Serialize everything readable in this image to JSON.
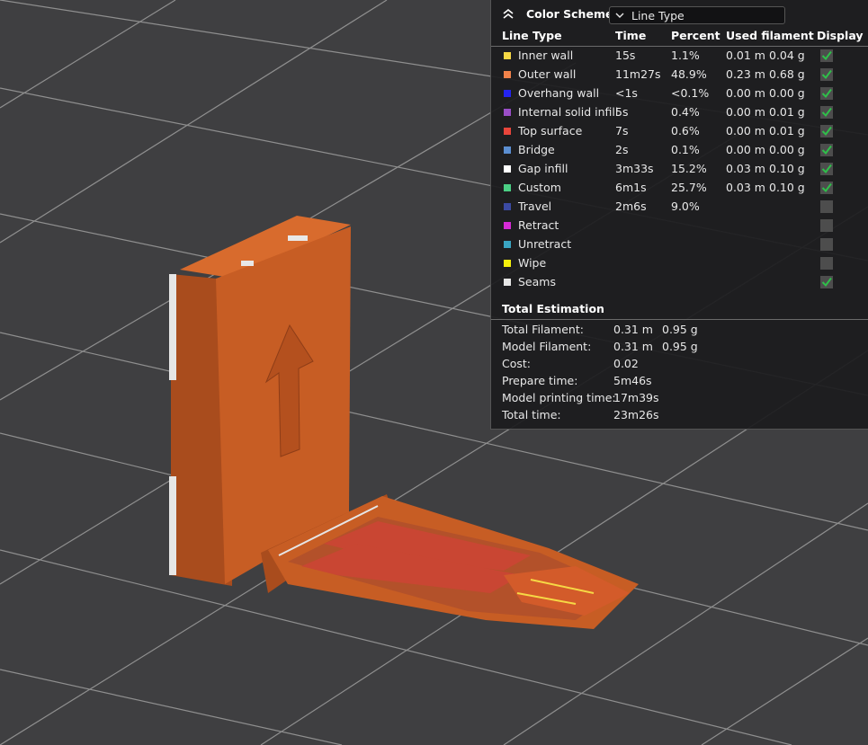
{
  "legend": {
    "scheme_label": "Color Scheme",
    "scheme_value": "Line Type",
    "headers": [
      "Line Type",
      "Time",
      "Percent",
      "Used filament",
      "Display"
    ],
    "rows": [
      {
        "name": "Inner wall",
        "color": "#f6d845",
        "time": "15s",
        "percent": "1.1%",
        "length": "0.01 m",
        "weight": "0.04 g",
        "checked": true
      },
      {
        "name": "Outer wall",
        "color": "#f0824a",
        "time": "11m27s",
        "percent": "48.9%",
        "length": "0.23 m",
        "weight": "0.68 g",
        "checked": true
      },
      {
        "name": "Overhang wall",
        "color": "#2424f0",
        "time": "<1s",
        "percent": "<0.1%",
        "length": "0.00 m",
        "weight": "0.00 g",
        "checked": true
      },
      {
        "name": "Internal solid infill",
        "color": "#9a4ec7",
        "time": "5s",
        "percent": "0.4%",
        "length": "0.00 m",
        "weight": "0.01 g",
        "checked": true
      },
      {
        "name": "Top surface",
        "color": "#e8453b",
        "time": "7s",
        "percent": "0.6%",
        "length": "0.00 m",
        "weight": "0.01 g",
        "checked": true
      },
      {
        "name": "Bridge",
        "color": "#5b8ed1",
        "time": "2s",
        "percent": "0.1%",
        "length": "0.00 m",
        "weight": "0.00 g",
        "checked": true
      },
      {
        "name": "Gap infill",
        "color": "#ffffff",
        "time": "3m33s",
        "percent": "15.2%",
        "length": "0.03 m",
        "weight": "0.10 g",
        "checked": true
      },
      {
        "name": "Custom",
        "color": "#4bcf84",
        "time": "6m1s",
        "percent": "25.7%",
        "length": "0.03 m",
        "weight": "0.10 g",
        "checked": true
      },
      {
        "name": "Travel",
        "color": "#3b4aa3",
        "time": "2m6s",
        "percent": "9.0%",
        "length": "",
        "weight": "",
        "checked": false
      },
      {
        "name": "Retract",
        "color": "#d62ad6",
        "time": "",
        "percent": "",
        "length": "",
        "weight": "",
        "checked": false
      },
      {
        "name": "Unretract",
        "color": "#3aa5c2",
        "time": "",
        "percent": "",
        "length": "",
        "weight": "",
        "checked": false
      },
      {
        "name": "Wipe",
        "color": "#f5f00c",
        "time": "",
        "percent": "",
        "length": "",
        "weight": "",
        "checked": false
      },
      {
        "name": "Seams",
        "color": "#e6e6e6",
        "time": "",
        "percent": "",
        "length": "",
        "weight": "",
        "checked": true
      }
    ],
    "totals_title": "Total Estimation",
    "totals": [
      {
        "label": "Total Filament:",
        "v1": "0.31 m",
        "v2": "0.95 g"
      },
      {
        "label": "Model Filament:",
        "v1": "0.31 m",
        "v2": "0.95 g"
      },
      {
        "label": "Cost:",
        "v1": "0.02",
        "v2": ""
      },
      {
        "label": "Prepare time:",
        "v1": "5m46s",
        "v2": ""
      },
      {
        "label": "Model printing time:",
        "v1": "17m39s",
        "v2": ""
      },
      {
        "label": "Total time:",
        "v1": "23m26s",
        "v2": ""
      }
    ]
  },
  "colors": {
    "plate": "#3f3f41",
    "grid": "#8a8a8a",
    "model_front": "#c75d24",
    "model_side": "#a94c1d",
    "model_top": "#d86b2d",
    "check_green": "#2fbf4a"
  }
}
